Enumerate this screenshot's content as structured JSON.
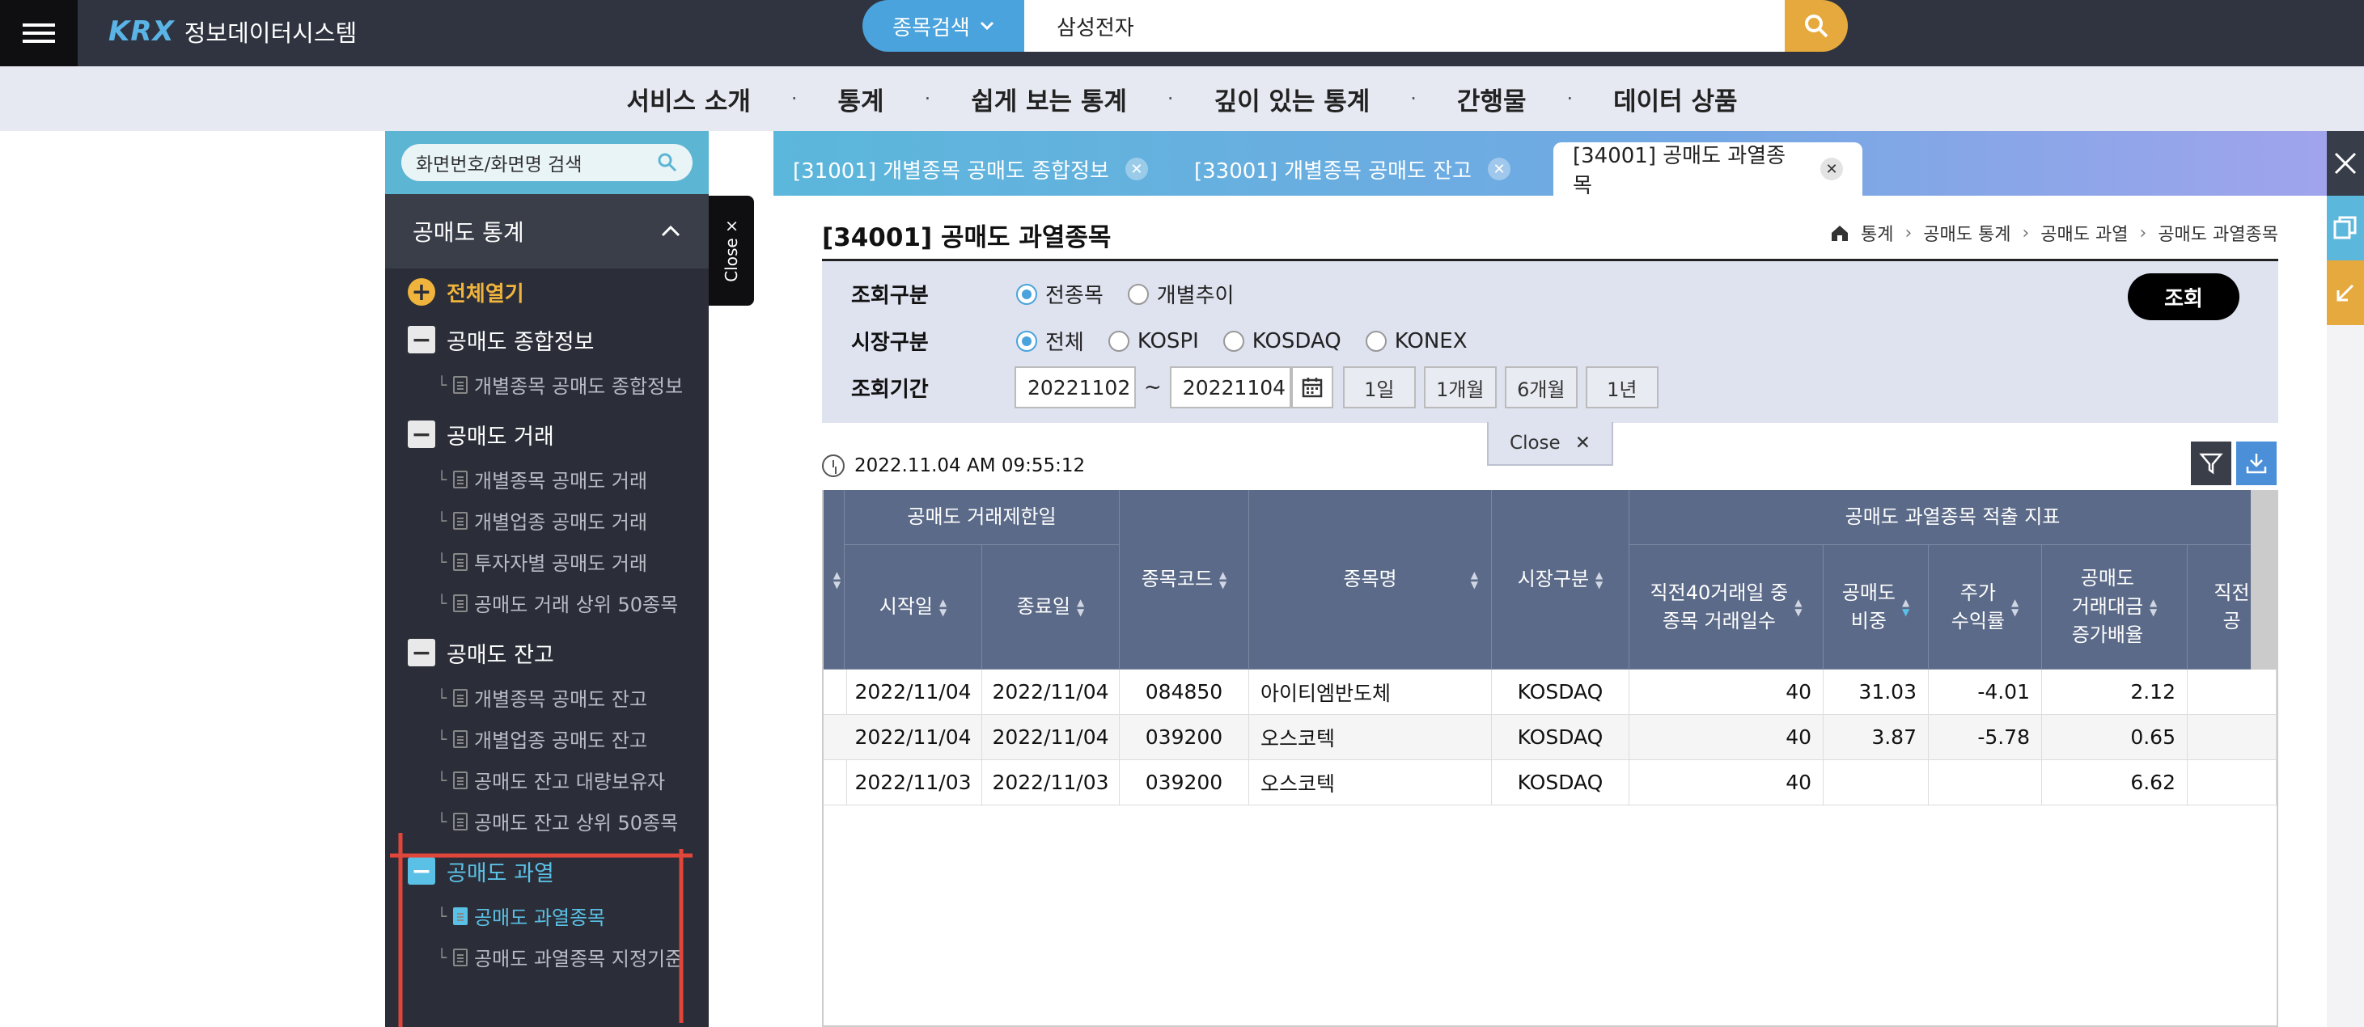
{
  "header": {
    "logo_mark": "KRX",
    "logo_text": "정보데이터시스템",
    "search_select": "종목검색",
    "search_value": "삼성전자"
  },
  "menu": [
    "서비스 소개",
    "통계",
    "쉽게 보는 통계",
    "깊이 있는 통계",
    "간행물",
    "데이터 상품"
  ],
  "sidebar": {
    "search_placeholder": "화면번호/화면명 검색",
    "section_title": "공매도 통계",
    "open_all": "전체열기",
    "close_label": "Close",
    "groups": [
      {
        "label": "공매도 종합정보",
        "items": [
          "개별종목 공매도 종합정보"
        ]
      },
      {
        "label": "공매도 거래",
        "items": [
          "개별종목 공매도 거래",
          "개별업종 공매도 거래",
          "투자자별 공매도 거래",
          "공매도 거래 상위 50종목"
        ]
      },
      {
        "label": "공매도 잔고",
        "items": [
          "개별종목 공매도 잔고",
          "개별업종 공매도 잔고",
          "공매도 잔고 대량보유자",
          "공매도 잔고 상위 50종목"
        ]
      },
      {
        "label": "공매도 과열",
        "items": [
          "공매도 과열종목",
          "공매도 과열종목 지정기준"
        ]
      }
    ]
  },
  "tabs": [
    "[31001] 개별종목 공매도 종합정보",
    "[33001] 개별종목 공매도 잔고",
    "[34001] 공매도 과열종목"
  ],
  "page": {
    "title": "[34001] 공매도 과열종목",
    "breadcrumb": [
      "통계",
      "공매도 통계",
      "공매도 과열",
      "공매도 과열종목"
    ]
  },
  "form": {
    "query_type_label": "조회구분",
    "query_type_options": [
      "전종목",
      "개별추이"
    ],
    "query_type_selected": "전종목",
    "market_label": "시장구분",
    "market_options": [
      "전체",
      "KOSPI",
      "KOSDAQ",
      "KONEX"
    ],
    "market_selected": "전체",
    "period_label": "조회기간",
    "date_from": "20221102",
    "date_sep": "~",
    "date_to": "20221104",
    "period_buttons": [
      "1일",
      "1개월",
      "6개월",
      "1년"
    ],
    "submit": "조회",
    "close_label": "Close"
  },
  "timestamp": "2022.11.04 AM 09:55:12",
  "table": {
    "group_headers": [
      "공매도 거래제한일",
      "공매도 과열종목 적출 지표"
    ],
    "headers": [
      "시작일",
      "종료일",
      "종목코드",
      "종목명",
      "시장구분",
      "직전40거래일 중\n종목 거래일수",
      "공매도\n비중",
      "주가\n수익률",
      "공매도\n거래대금\n증가배율",
      "직전\n공"
    ],
    "rows": [
      [
        "2022/11/04",
        "2022/11/04",
        "084850",
        "아이티엠반도체",
        "KOSDAQ",
        "40",
        "31.03",
        "-4.01",
        "2.12",
        ""
      ],
      [
        "2022/11/04",
        "2022/11/04",
        "039200",
        "오스코텍",
        "KOSDAQ",
        "40",
        "3.87",
        "-5.78",
        "0.65",
        ""
      ],
      [
        "2022/11/03",
        "2022/11/03",
        "039200",
        "오스코텍",
        "KOSDAQ",
        "40",
        "",
        "",
        "6.62",
        ""
      ]
    ]
  },
  "colors": {
    "topbar": "#2f3440",
    "accent_blue": "#4aa3dc",
    "search_button": "#e5a93d",
    "sidebar": "#2b2e38",
    "table_header": "#5b6a88",
    "annotation_red": "#e0463a"
  }
}
